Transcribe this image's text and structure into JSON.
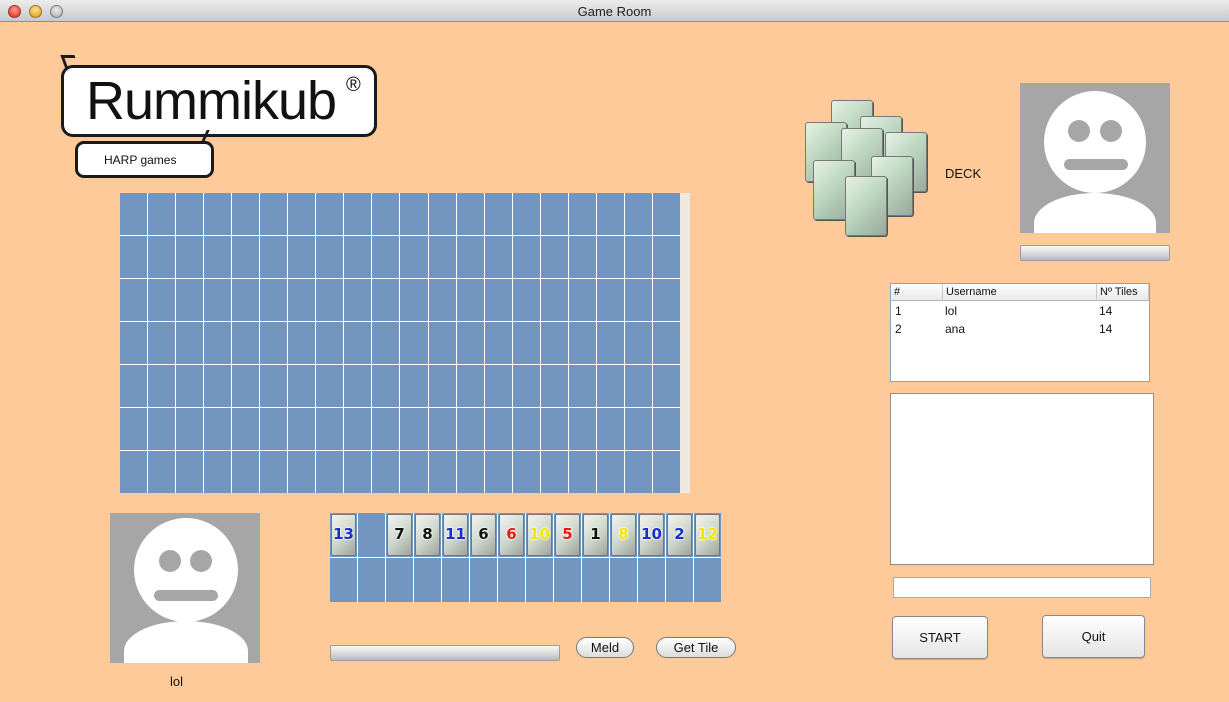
{
  "window": {
    "title": "Game Room"
  },
  "logo": {
    "name": "Rummikub",
    "registered": "®",
    "studio": "HARP games"
  },
  "deck": {
    "label": "DECK"
  },
  "players_table": {
    "columns": [
      "#",
      "Username",
      "Nº Tiles"
    ],
    "rows": [
      {
        "num": "1",
        "username": "lol",
        "tiles": "14"
      },
      {
        "num": "2",
        "username": "ana",
        "tiles": "14"
      }
    ]
  },
  "rack": {
    "tiles": [
      {
        "value": "13",
        "color": "#1a2fc9"
      },
      null,
      {
        "value": "7",
        "color": "#111111"
      },
      {
        "value": "8",
        "color": "#111111"
      },
      {
        "value": "11",
        "color": "#1a2fc9"
      },
      {
        "value": "6",
        "color": "#111111"
      },
      {
        "value": "6",
        "color": "#e01c1c"
      },
      {
        "value": "10",
        "color": "#f2e600"
      },
      {
        "value": "5",
        "color": "#e01c1c"
      },
      {
        "value": "1",
        "color": "#111111"
      },
      {
        "value": "8",
        "color": "#f2e600"
      },
      {
        "value": "10",
        "color": "#1a2fc9"
      },
      {
        "value": "2",
        "color": "#1a2fc9"
      },
      {
        "value": "12",
        "color": "#f2e600"
      }
    ]
  },
  "controls": {
    "meld": "Meld",
    "get_tile": "Get Tile",
    "start": "START",
    "quit": "Quit"
  },
  "me": {
    "username": "lol"
  },
  "colors": {
    "background": "#FFCA99",
    "board": "#7396C1",
    "avatar": "#a6a6a6"
  },
  "icons": {
    "avatar": "default-user-icon",
    "deck": "tile-stack-icon"
  }
}
